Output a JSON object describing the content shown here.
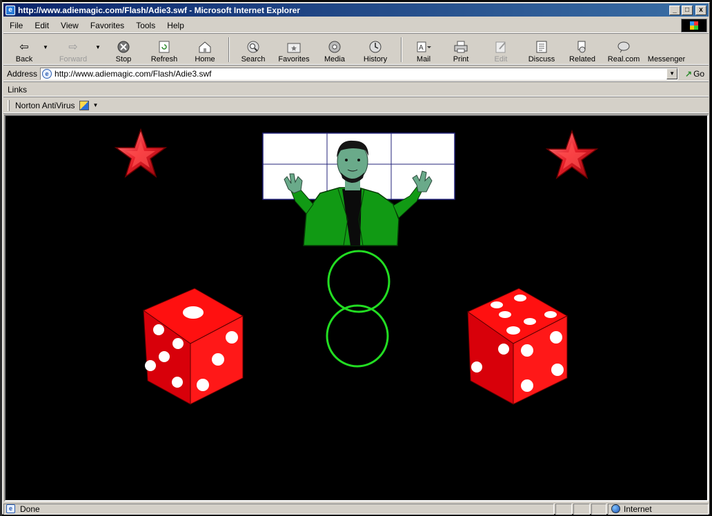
{
  "window": {
    "title": "http://www.adiemagic.com/Flash/Adie3.swf - Microsoft Internet Explorer",
    "ie_glyph": "e"
  },
  "title_buttons": {
    "minimize": "_",
    "maximize": "□",
    "close": "x"
  },
  "menu": [
    {
      "label": "File",
      "key": "F"
    },
    {
      "label": "Edit",
      "key": "E"
    },
    {
      "label": "View",
      "key": "V"
    },
    {
      "label": "Favorites",
      "key": "a"
    },
    {
      "label": "Tools",
      "key": "T"
    },
    {
      "label": "Help",
      "key": "H"
    }
  ],
  "toolbar": {
    "back": "Back",
    "forward": "Forward",
    "stop": "Stop",
    "refresh": "Refresh",
    "home": "Home",
    "search": "Search",
    "favorites": "Favorites",
    "media": "Media",
    "history": "History",
    "mail": "Mail",
    "print": "Print",
    "edit": "Edit",
    "discuss": "Discuss",
    "related": "Related",
    "realcom": "Real.com",
    "messenger": "Messenger"
  },
  "address": {
    "label": "Address",
    "value": "http://www.adiemagic.com/Flash/Adie3.swf",
    "go": "Go"
  },
  "links": {
    "label": "Links"
  },
  "norton": {
    "label": "Norton AntiVirus"
  },
  "status": {
    "text": "Done",
    "zone": "Internet"
  },
  "colors": {
    "star": "#e8202a",
    "die": "#e8101a",
    "pip": "#ffffff",
    "jacket": "#119a14",
    "ring": "#22dd22",
    "face": "#6aaa8a"
  }
}
